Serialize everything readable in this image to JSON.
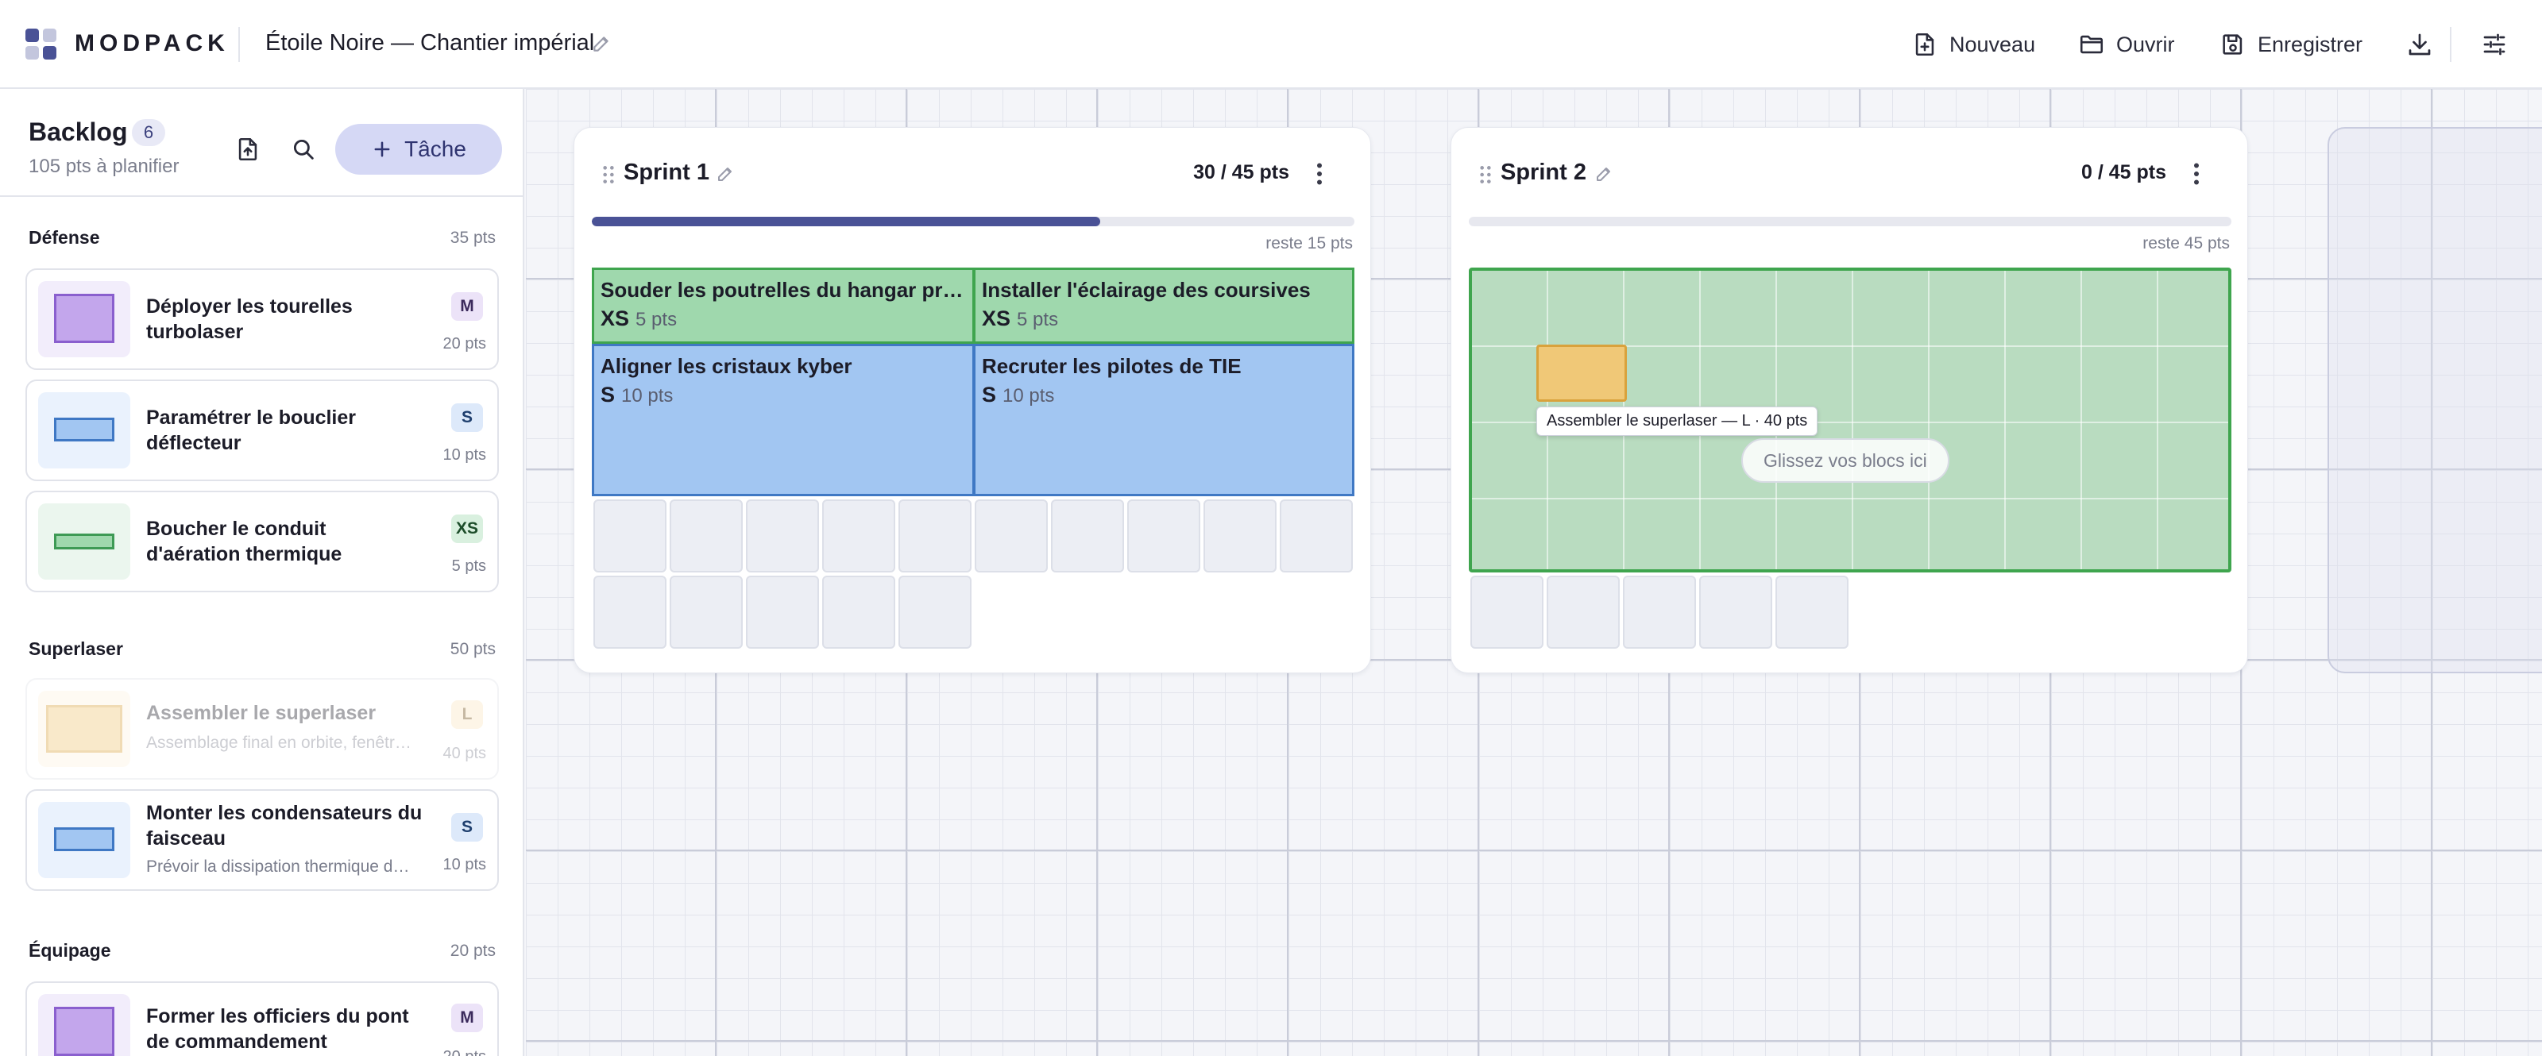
{
  "header": {
    "brand": "MODPACK",
    "project_title": "Étoile Noire — Chantier impérial",
    "actions": {
      "new_label": "Nouveau",
      "open_label": "Ouvrir",
      "save_label": "Enregistrer"
    },
    "icons": [
      "app-logo-icon",
      "pencil-icon",
      "file-plus-icon",
      "folder-icon",
      "save-icon",
      "download-icon",
      "sliders-icon"
    ]
  },
  "backlog": {
    "title": "Backlog",
    "count": "6",
    "subtitle": "105 pts à planifier",
    "add_task_label": "Tâche",
    "groups": [
      {
        "name": "Défense",
        "points": "35 pts",
        "tasks": [
          {
            "title": "Déployer les tourelles turbolaser",
            "size": "M",
            "points": "20 pts",
            "color": "#c3a6ec"
          },
          {
            "title": "Paramétrer le bouclier déflecteur",
            "size": "S",
            "points": "10 pts",
            "color": "#a2c6f2"
          },
          {
            "title": "Boucher le conduit d'aération thermique",
            "size": "XS",
            "points": "5 pts",
            "color": "#9fd8ad"
          }
        ]
      },
      {
        "name": "Superlaser",
        "points": "50 pts",
        "tasks": [
          {
            "title": "Assembler le superlaser",
            "description": "Assemblage final en orbite, fenêtr…",
            "size": "L",
            "points": "40 pts",
            "color": "#f0c877",
            "dragging": true
          },
          {
            "title": "Monter les condensateurs du faisceau",
            "description": "Prévoir la dissipation thermique d…",
            "size": "S",
            "points": "10 pts",
            "color": "#a2c6f2"
          }
        ]
      },
      {
        "name": "Équipage",
        "points": "20 pts",
        "tasks": [
          {
            "title": "Former les officiers du pont de commandement",
            "size": "M",
            "points": "20 pts",
            "color": "#c3a6ec"
          }
        ]
      }
    ]
  },
  "sprints": [
    {
      "name": "Sprint 1",
      "capacity": "30 / 45 pts",
      "remaining": "reste 15 pts",
      "progress": 0.667,
      "blocks": [
        {
          "title": "Souder les poutrelles du hangar prin…",
          "size": "XS",
          "points": "5 pts"
        },
        {
          "title": "Installer l'éclairage des coursives",
          "size": "XS",
          "points": "5 pts"
        },
        {
          "title": "Aligner les cristaux kyber",
          "size": "S",
          "points": "10 pts"
        },
        {
          "title": "Recruter les pilotes de TIE",
          "size": "S",
          "points": "10 pts"
        }
      ]
    },
    {
      "name": "Sprint 2",
      "capacity": "0 / 45 pts",
      "remaining": "reste 45 pts",
      "progress": 0,
      "drop_hint": "Glissez vos blocs ici",
      "drag_tooltip": "Assembler le superlaser — L · 40 pts"
    }
  ],
  "colors": {
    "accent": "#4a5296",
    "xs_block": "#9fd8ad",
    "s_block": "#a2c6f2",
    "m_block": "#c3a6ec",
    "l_block": "#f0c877",
    "drop_zone": "#3fa54e"
  }
}
